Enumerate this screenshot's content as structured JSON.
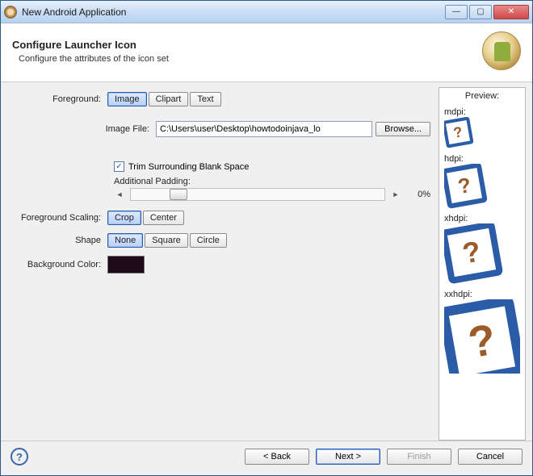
{
  "window": {
    "title": "New Android Application"
  },
  "header": {
    "title": "Configure Launcher Icon",
    "subtitle": "Configure the attributes of the icon set"
  },
  "form": {
    "foreground_label": "Foreground:",
    "foreground_options": {
      "image": "Image",
      "clipart": "Clipart",
      "text": "Text"
    },
    "image_file_label": "Image File:",
    "image_file_value": "C:\\Users\\user\\Desktop\\howtodoinjava_lo",
    "browse_label": "Browse...",
    "trim_label": "Trim Surrounding Blank Space",
    "trim_checked": true,
    "padding_label": "Additional Padding:",
    "padding_value": "0%",
    "scaling_label": "Foreground Scaling:",
    "scaling_options": {
      "crop": "Crop",
      "center": "Center"
    },
    "shape_label": "Shape",
    "shape_options": {
      "none": "None",
      "square": "Square",
      "circle": "Circle"
    },
    "bgcolor_label": "Background Color:",
    "bgcolor_value": "#1f0a1a"
  },
  "preview": {
    "title": "Preview:",
    "sizes": {
      "mdpi": "mdpi:",
      "hdpi": "hdpi:",
      "xhdpi": "xhdpi:",
      "xxhdpi": "xxhdpi:"
    }
  },
  "footer": {
    "back": "< Back",
    "next": "Next >",
    "finish": "Finish",
    "cancel": "Cancel"
  }
}
